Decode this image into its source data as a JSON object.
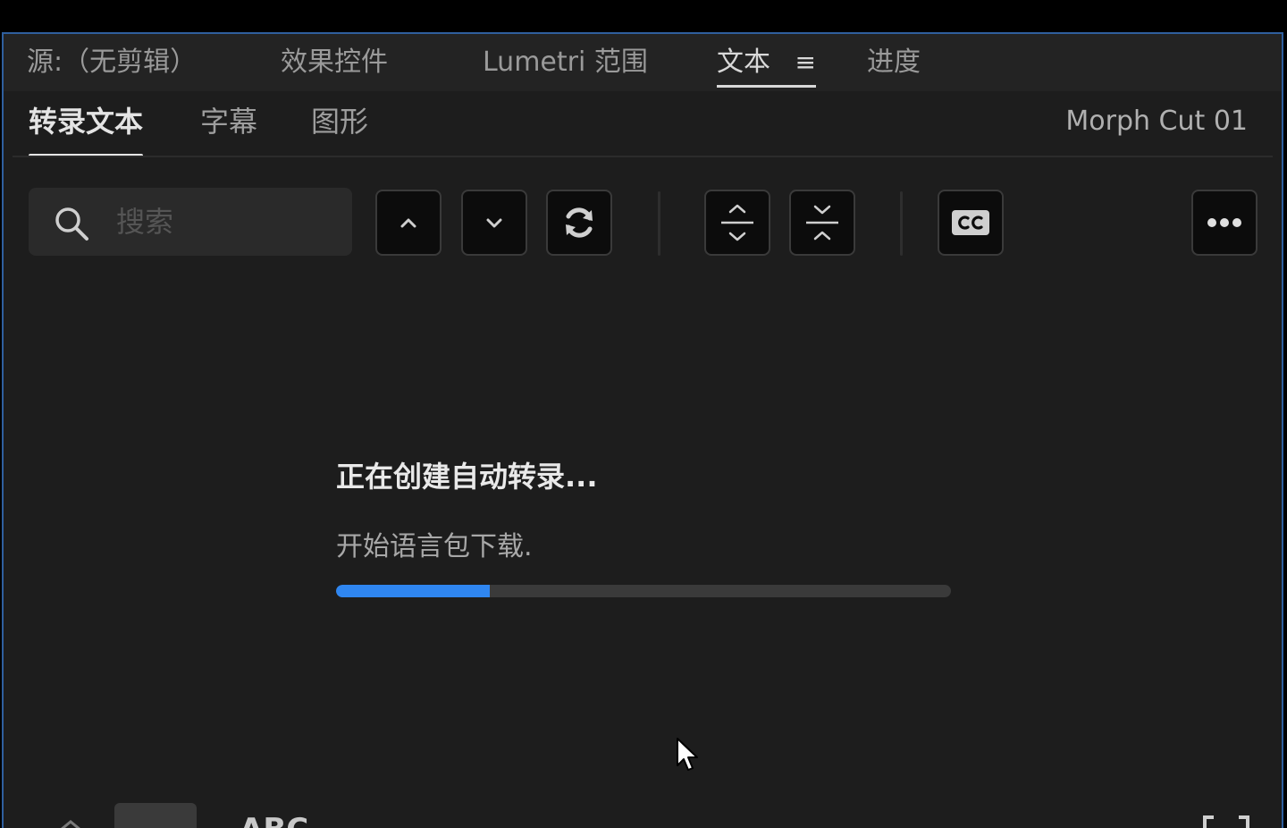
{
  "panel_tabs": [
    {
      "label": "源:（无剪辑）",
      "active": false
    },
    {
      "label": "效果控件",
      "active": false
    },
    {
      "label": "Lumetri 范围",
      "active": false
    },
    {
      "label": "文本",
      "active": true
    },
    {
      "label": "进度",
      "active": false
    }
  ],
  "panel_menu_icon": "hamburger-menu-icon",
  "subtabs": [
    {
      "label": "转录文本",
      "active": true
    },
    {
      "label": "字幕",
      "active": false
    },
    {
      "label": "图形",
      "active": false
    }
  ],
  "sequence_name": "Morph Cut 01",
  "search": {
    "placeholder": "搜索",
    "value": ""
  },
  "toolbar": [
    {
      "name": "previous-result",
      "icon": "chevron-up-icon"
    },
    {
      "name": "next-result",
      "icon": "chevron-down-icon"
    },
    {
      "name": "refresh",
      "icon": "refresh-icon"
    },
    {
      "name": "expand-all",
      "icon": "expand-vertical-icon"
    },
    {
      "name": "collapse-all",
      "icon": "collapse-vertical-icon"
    },
    {
      "name": "captions",
      "icon": "cc-icon"
    },
    {
      "name": "more",
      "icon": "more-horizontal-icon"
    }
  ],
  "status": {
    "title": "正在创建自动转录...",
    "message": "开始语言包下载.",
    "progress": 0.25
  },
  "colors": {
    "panel_border": "#2f5f9e",
    "progress_fill": "#2f86f0",
    "progress_track": "#3a3a3a",
    "panel_bg": "#1d1d1d"
  }
}
